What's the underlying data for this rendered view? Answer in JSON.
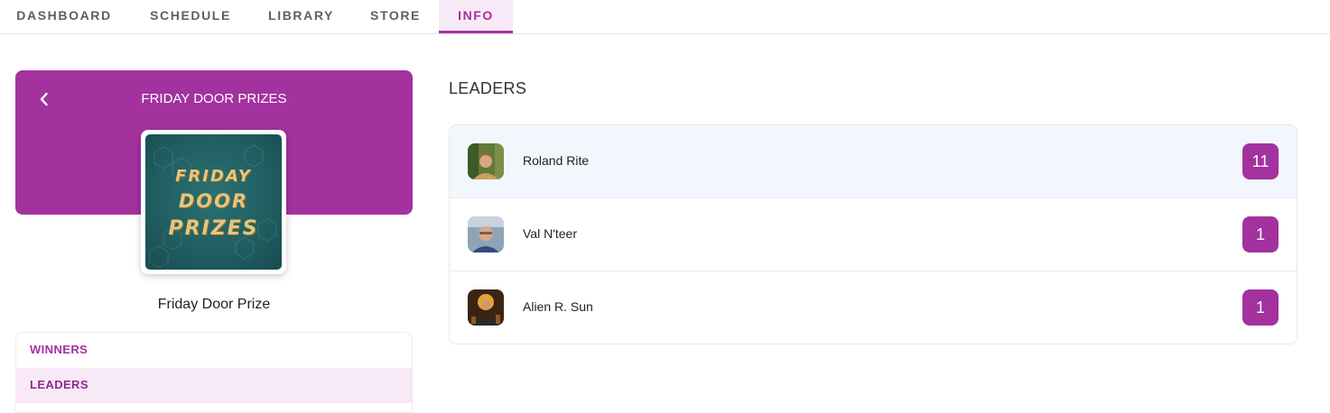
{
  "nav": {
    "tabs": [
      {
        "label": "DASHBOARD"
      },
      {
        "label": "SCHEDULE"
      },
      {
        "label": "LIBRARY"
      },
      {
        "label": "STORE"
      },
      {
        "label": "INFO"
      }
    ],
    "active_tab": "INFO"
  },
  "card": {
    "back_icon": "chevron-left-icon",
    "title": "FRIDAY DOOR PRIZES",
    "thumbnail_lines": [
      "FRIDAY",
      "DOOR",
      "PRIZES"
    ],
    "name": "Friday Door Prize",
    "menu": [
      {
        "label": "WINNERS"
      },
      {
        "label": "LEADERS"
      }
    ],
    "active_menu": "LEADERS"
  },
  "leaders": {
    "title": "LEADERS",
    "rows": [
      {
        "name": "Roland Rite",
        "count": "11"
      },
      {
        "name": "Val N'teer",
        "count": "1"
      },
      {
        "name": "Alien R. Sun",
        "count": "1"
      }
    ]
  },
  "colors": {
    "accent": "#a3329f",
    "accent_light": "#f8e9f7",
    "row_highlight": "#f2f7fd"
  }
}
